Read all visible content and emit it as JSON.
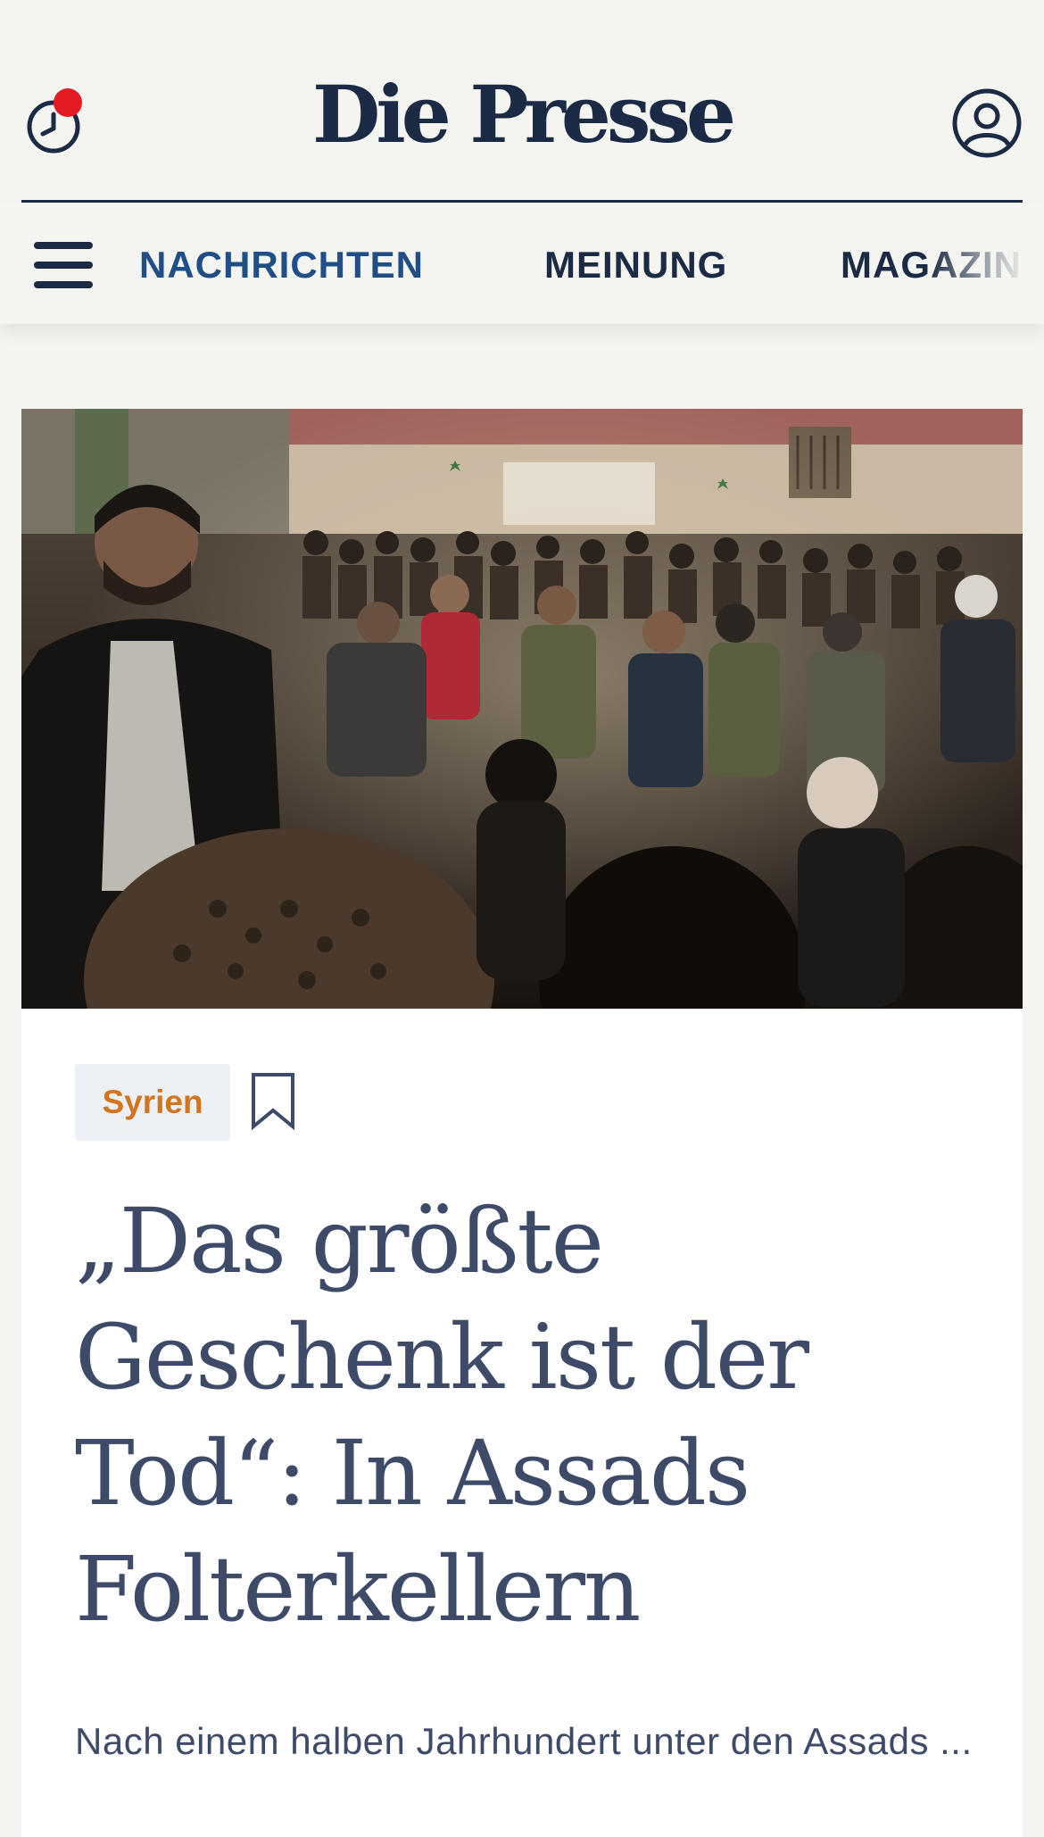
{
  "header": {
    "brand": "Die Presse",
    "history_icon": "clock-icon",
    "notification_dot_color": "#e31b23",
    "account_icon": "user-icon"
  },
  "nav": {
    "menu_icon": "hamburger-menu-icon",
    "items": [
      {
        "label": "NACHRICHTEN",
        "active": true
      },
      {
        "label": "MEINUNG",
        "active": false
      },
      {
        "label": "MAGAZIN",
        "active": false
      }
    ]
  },
  "article": {
    "topic": "Syrien",
    "bookmark_icon": "bookmark-icon",
    "headline": "„Das größte Geschenk ist der Tod“: In Assads Folterkellern",
    "lead": "Nach einem halben Jahrhundert unter den Assads ..."
  },
  "colors": {
    "brand_navy": "#1c2b45",
    "nav_active": "#1f4f86",
    "headline": "#3d4a68",
    "topic_text": "#d3741f",
    "topic_bg": "#edf0f4",
    "page_bg": "#f4f4f0"
  }
}
